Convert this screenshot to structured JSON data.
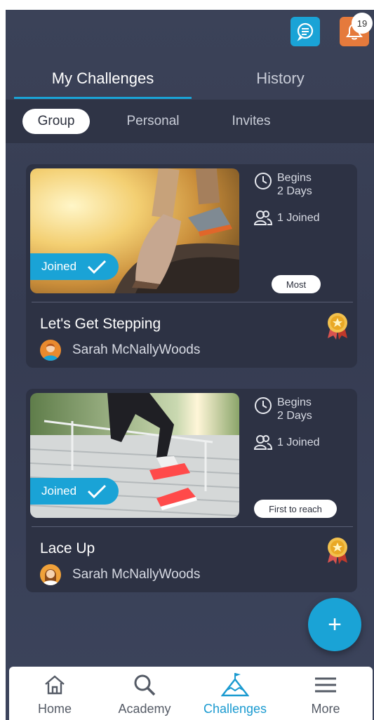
{
  "header": {
    "notification_count": "19"
  },
  "tabs": [
    {
      "label": "My Challenges"
    },
    {
      "label": "History"
    }
  ],
  "subtabs": [
    {
      "label": "Group"
    },
    {
      "label": "Personal"
    },
    {
      "label": "Invites"
    }
  ],
  "cards": [
    {
      "joined_label": "Joined",
      "begins_label": "Begins",
      "begins_value": "2 Days",
      "joined_count": "1 Joined",
      "type_label": "Most",
      "title": "Let's Get Stepping",
      "owner": "Sarah McNallyWoods"
    },
    {
      "joined_label": "Joined",
      "begins_label": "Begins",
      "begins_value": "2 Days",
      "joined_count": "1 Joined",
      "type_label": "First to reach",
      "title": "Lace Up",
      "owner": "Sarah McNallyWoods"
    }
  ],
  "fab_label": "+",
  "nav": [
    {
      "label": "Home"
    },
    {
      "label": "Academy"
    },
    {
      "label": "Challenges"
    },
    {
      "label": "More"
    }
  ],
  "colors": {
    "accent": "#1aa3d6",
    "bell": "#e57a3c",
    "background": "#3b4258",
    "card": "#2d3244",
    "nav_active": "#1a9ad0"
  }
}
